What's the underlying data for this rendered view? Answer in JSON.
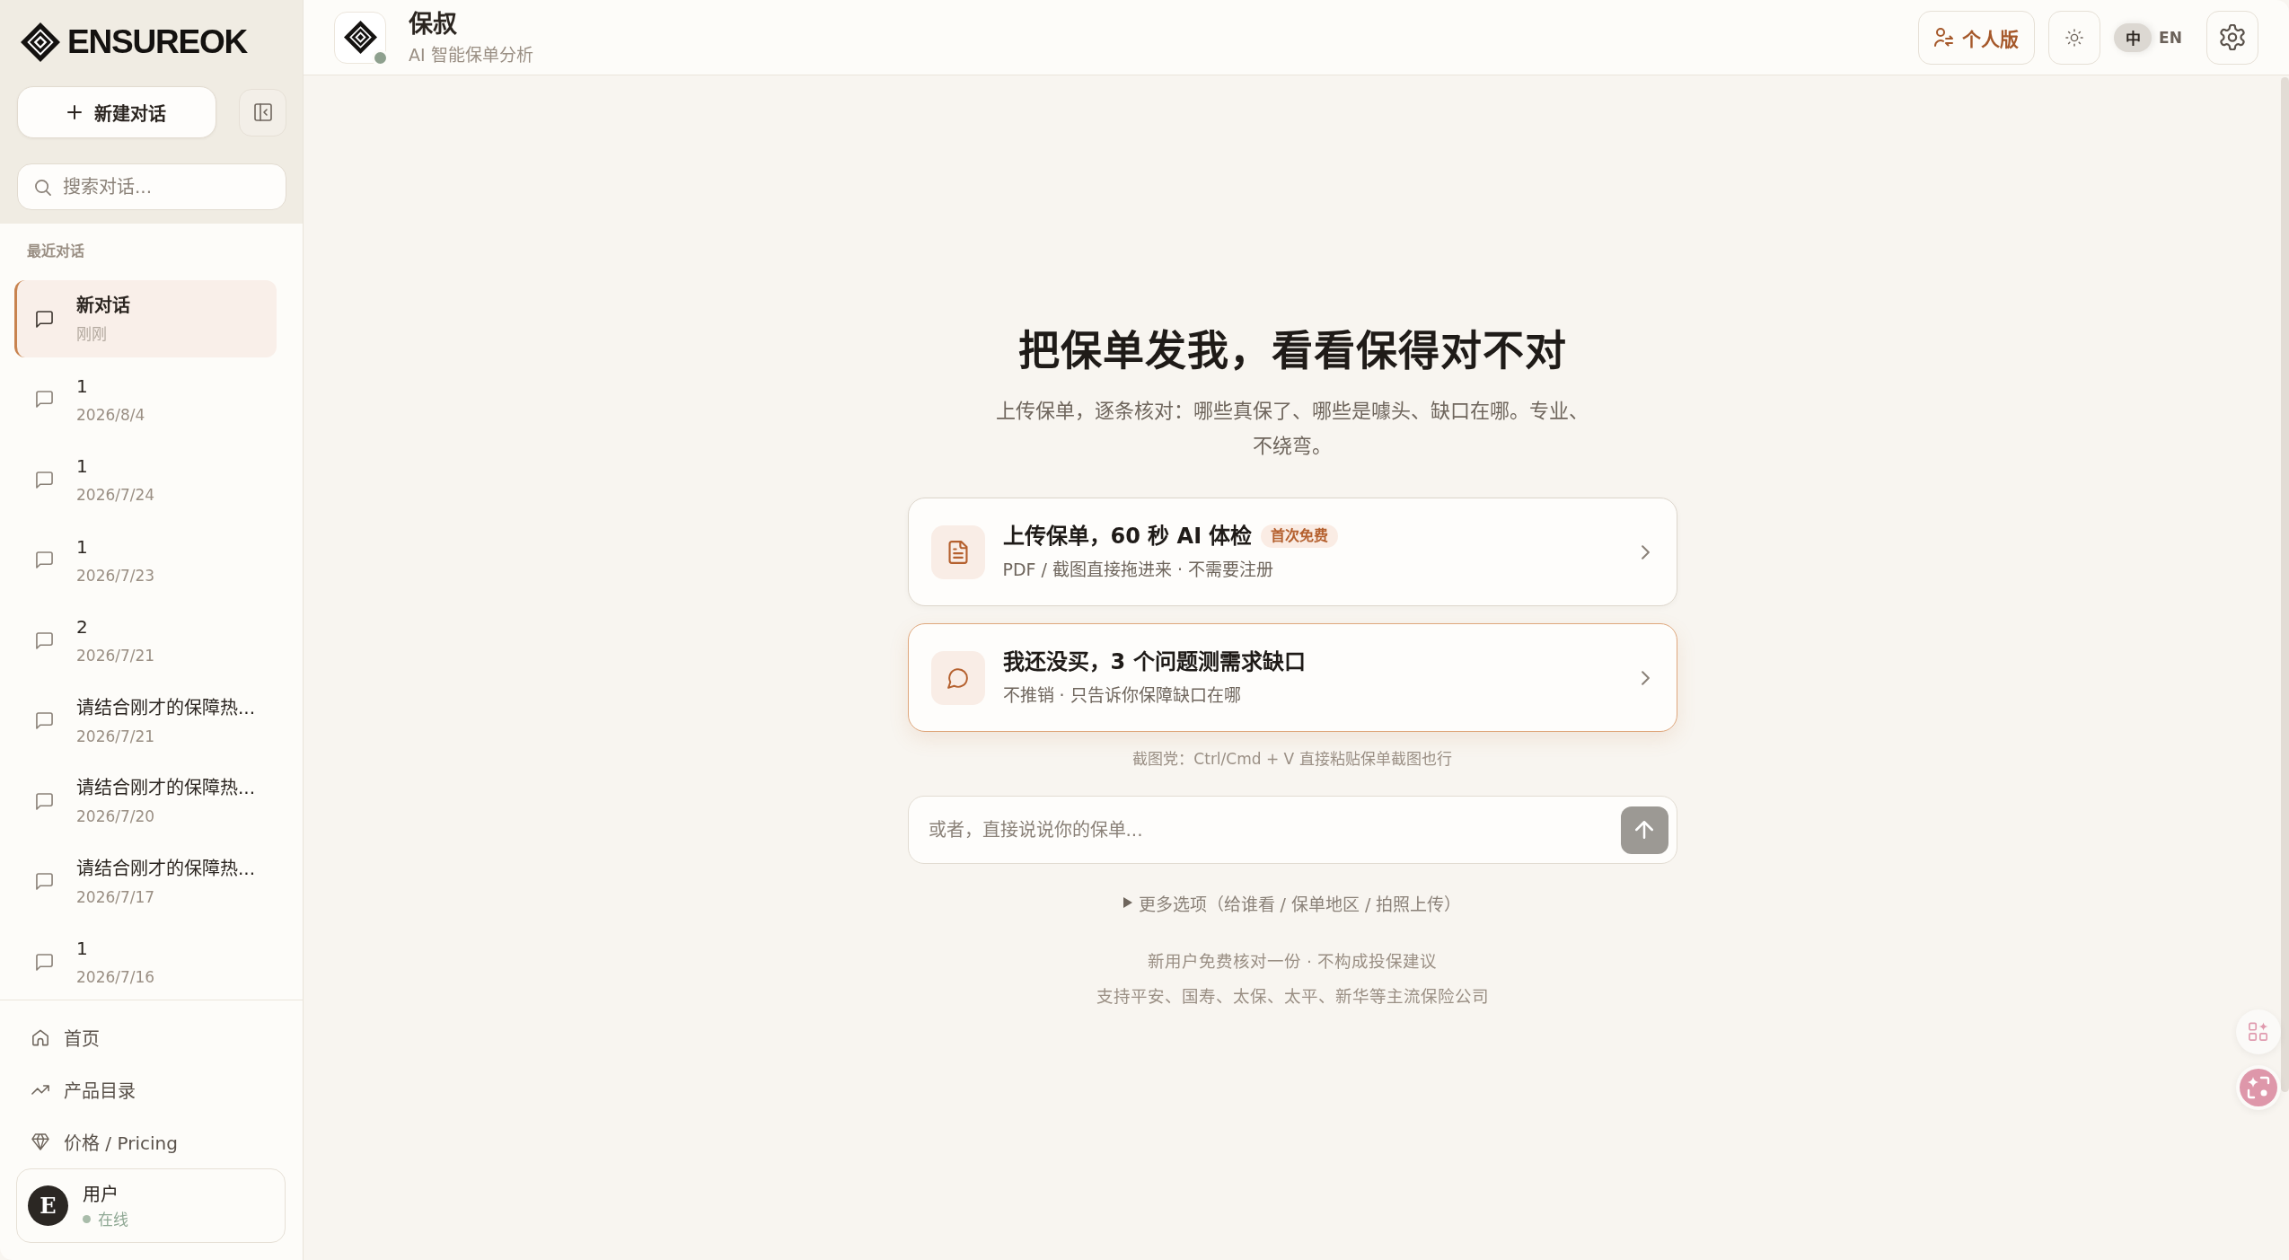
{
  "sidebar": {
    "brand": "ENSUREOK",
    "new_chat_label": "新建对话",
    "search_placeholder": "搜索对话...",
    "section_title": "最近对话",
    "conversations": [
      {
        "title": "新对话",
        "time": "刚刚",
        "selected": true
      },
      {
        "title": "1",
        "time": "2026/8/4",
        "selected": false
      },
      {
        "title": "1",
        "time": "2026/7/24",
        "selected": false
      },
      {
        "title": "1",
        "time": "2026/7/23",
        "selected": false
      },
      {
        "title": "2",
        "time": "2026/7/21",
        "selected": false
      },
      {
        "title": "请结合刚才的保障热...",
        "time": "2026/7/21",
        "selected": false
      },
      {
        "title": "请结合刚才的保障热...",
        "time": "2026/7/20",
        "selected": false
      },
      {
        "title": "请结合刚才的保障热...",
        "time": "2026/7/17",
        "selected": false
      },
      {
        "title": "1",
        "time": "2026/7/16",
        "selected": false
      }
    ],
    "nav": [
      {
        "kind": "home",
        "label": "首页"
      },
      {
        "kind": "trend",
        "label": "产品目录"
      },
      {
        "kind": "gem",
        "label": "价格 / Pricing"
      }
    ],
    "user": {
      "avatar_letter": "E",
      "name": "用户",
      "status": "在线",
      "online": true
    }
  },
  "header": {
    "title": "保叔",
    "subtitle": "AI 智能保单分析",
    "online": true,
    "edition_button": "个人版",
    "languages": [
      {
        "label": "中",
        "selected": true
      },
      {
        "label": "EN",
        "selected": false
      }
    ]
  },
  "main": {
    "heading": "把保单发我，看看保得对不对",
    "intro": "上传保单，逐条核对：哪些真保了、哪些是噱头、缺口在哪。专业、不绕弯。",
    "options": [
      {
        "kind": "upload",
        "title": "上传保单，60 秒 AI 体检",
        "badge": "首次免费",
        "subtitle": "PDF / 截图直接拖进来 · 不需要注册",
        "selected": false
      },
      {
        "kind": "chat",
        "title": "我还没买，3 个问题测需求缺口",
        "subtitle": "不推销 · 只告诉你保障缺口在哪",
        "selected": true
      }
    ],
    "paste_hint": "截图党：Ctrl/Cmd + V 直接粘贴保单截图也行",
    "composer": {
      "placeholder": "或者，直接说说你的保单..."
    },
    "more_options": {
      "label": "更多选项（给谁看 / 保单地区 / 拍照上传）",
      "expanded": false
    },
    "footer": [
      "新用户免费核对一份 · 不构成投保建议",
      "支持平安、国寿、太保、太平、新华等主流保险公司"
    ]
  }
}
